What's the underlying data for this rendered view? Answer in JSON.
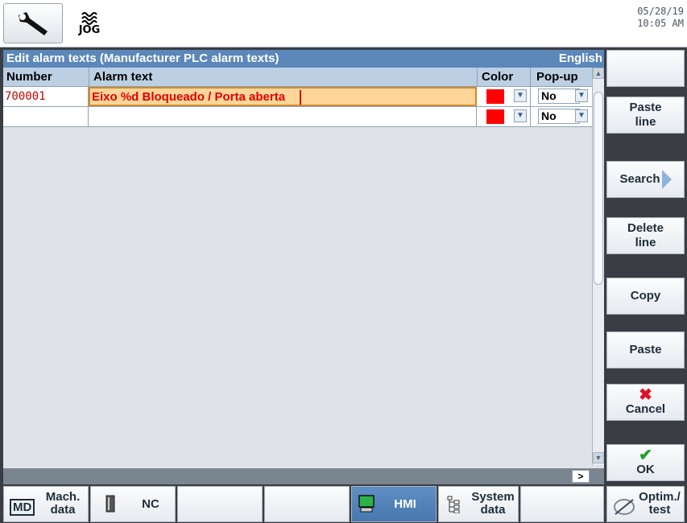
{
  "header": {
    "mode_label": "JOG",
    "date": "05/28/19",
    "time": "10:05 AM"
  },
  "panel": {
    "title": "Edit alarm texts (Manufacturer PLC alarm texts)",
    "language": "English",
    "columns": {
      "number": "Number",
      "alarm_text": "Alarm text",
      "color": "Color",
      "popup": "Pop-up"
    },
    "rows": [
      {
        "number": "700001",
        "text": "Eixo %d Bloqueado / Porta aberta",
        "color": "#ff0000",
        "popup": "No"
      },
      {
        "number": "",
        "text": "",
        "color": "#ff0000",
        "popup": "No"
      }
    ],
    "scroll_right_label": ">"
  },
  "softkeys_vertical": {
    "paste_line": "Paste line",
    "search": "Search",
    "delete_line": "Delete line",
    "copy": "Copy",
    "paste": "Paste",
    "cancel": "Cancel",
    "ok": "OK"
  },
  "softkeys_horizontal": {
    "mach_data": "Mach. data",
    "md_badge": "MD",
    "nc": "NC",
    "hmi": "HMI",
    "system_data": "System data",
    "optim_test": "Optim./ test"
  },
  "colors": {
    "accent": "#5b87b9",
    "alarm_text": "#e00000",
    "active_softkey": "#4677ad"
  }
}
